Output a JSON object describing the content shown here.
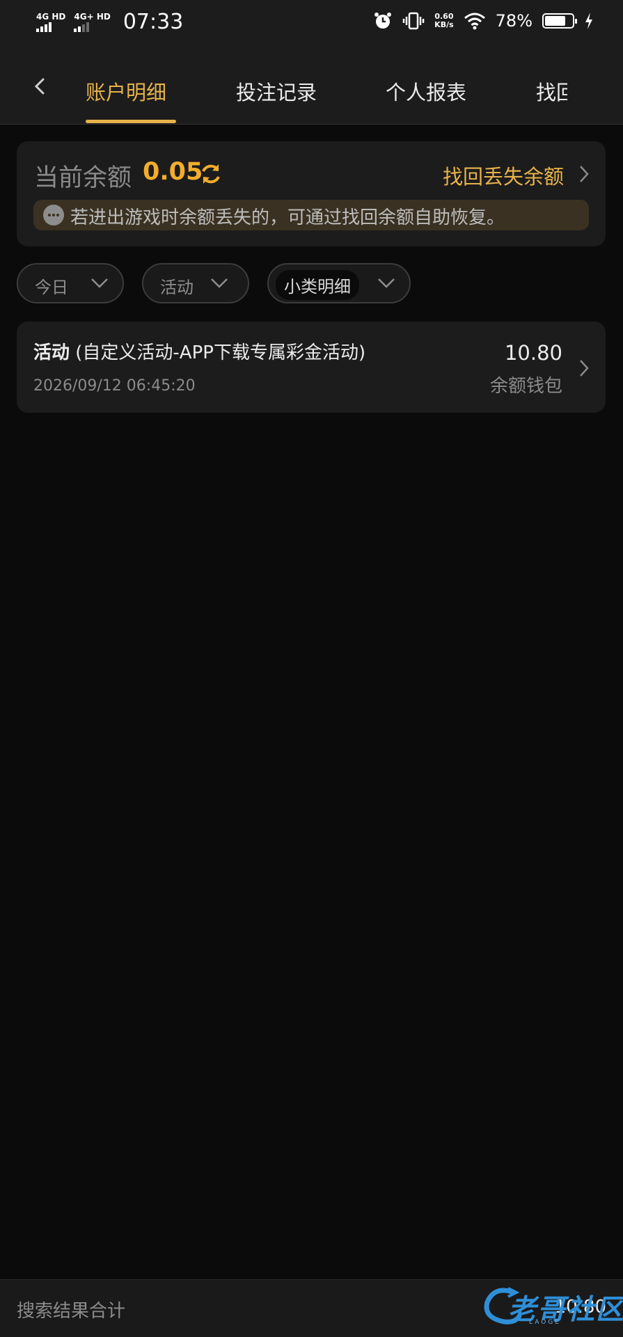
{
  "status_bar": {
    "signal1_label": "4G HD",
    "signal2_label": "4G+ HD",
    "time": "07:33",
    "net_speed_value": "0.60",
    "net_speed_unit": "KB/s",
    "battery_percent": "78%",
    "battery_level": 0.78,
    "icons": [
      "alarm-icon",
      "vibrate-icon",
      "wifi-icon",
      "battery-icon",
      "charging-icon"
    ]
  },
  "nav": {
    "tabs": [
      {
        "label": "账户明细",
        "active": true
      },
      {
        "label": "投注记录",
        "active": false
      },
      {
        "label": "个人报表",
        "active": false
      },
      {
        "label": "找回",
        "active": false
      }
    ]
  },
  "balance": {
    "label": "当前余额",
    "value": "0.05",
    "recover_link": "找回丢失余额",
    "notice": "若进出游戏时余额丢失的，可通过找回余额自助恢复。"
  },
  "filters": [
    {
      "label": "今日"
    },
    {
      "label": "活动"
    },
    {
      "label": "小类明细"
    }
  ],
  "records": [
    {
      "category": "活动",
      "detail": " (自定义活动-APP下载专属彩金活动)",
      "time": "2026/09/12 06:45:20",
      "amount": "10.80",
      "wallet": "余额钱包"
    }
  ],
  "footer": {
    "label": "搜索结果合计",
    "total": "10.80"
  },
  "watermark": {
    "text": "老哥社区",
    "sub": "LAOGE"
  },
  "colors": {
    "accent": "#e7b24a",
    "balance": "#f3ad2c",
    "background": "#0b0b0b",
    "card": "#1c1c1c"
  }
}
